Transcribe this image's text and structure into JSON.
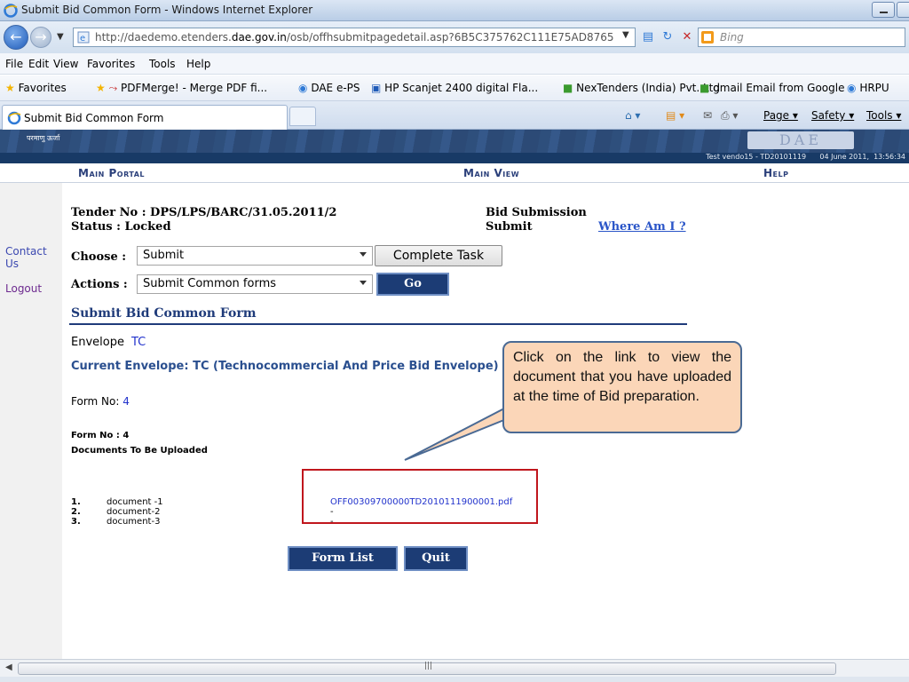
{
  "window": {
    "title": "Submit Bid Common Form - Windows Internet Explorer"
  },
  "address": {
    "url_prefix": "http://daedemo.etenders.",
    "url_domain": "dae.gov.in",
    "url_suffix": "/osb/offhsubmitpagedetail.asp?6B5C375762C111E75AD8765EI",
    "search_placeholder": "Bing"
  },
  "menu": [
    "File",
    "Edit",
    "View",
    "Favorites",
    "Tools",
    "Help"
  ],
  "favorites": {
    "label": "Favorites",
    "items": [
      "PDFMerge! - Merge PDF fi...",
      "DAE e-PS",
      "HP Scanjet 2400 digital Fla...",
      "NexTenders (India) Pvt. Ltd",
      "gmail Email from Google",
      "HRPU"
    ]
  },
  "tab": {
    "title": "Submit Bid Common Form",
    "tools": [
      "Page ▾",
      "Safety ▾",
      "Tools ▾"
    ]
  },
  "header": {
    "hindi_text": "परमाणु ऊर्जा",
    "logo_text": "DAE",
    "info": "Test vendo15 - TD20101119      04 June 2011,  13:56:34"
  },
  "nav": {
    "main_portal": "Main Portal",
    "main_view": "Main View",
    "help": "Help"
  },
  "sidebar": {
    "contact": "Contact Us",
    "logout": "Logout"
  },
  "tender": {
    "tender_no": "Tender No : DPS/LPS/BARC/31.05.2011/2",
    "status": "Status : Locked",
    "bid_submission": "Bid Submission",
    "submit": "Submit",
    "where_am_i": "Where Am I ?"
  },
  "form": {
    "choose_label": "Choose :",
    "choose_value": "Submit",
    "complete_task": "Complete Task",
    "actions_label": "Actions :",
    "actions_value": "Submit Common forms",
    "go": "Go",
    "section_title": "Submit Bid Common Form",
    "envelope_label": "Envelope",
    "envelope_value": "TC",
    "current_envelope": "Current Envelope: TC (Technocommercial And Price Bid Envelope)",
    "form_no_label": "Form No:",
    "form_no_value": "4",
    "form_no_small": "Form No : 4",
    "documents_heading": "Documents To Be Uploaded"
  },
  "documents": [
    {
      "num": "1.",
      "name": "document -1",
      "file": "OFF00309700000TD2010111900001.pdf"
    },
    {
      "num": "2.",
      "name": "document-2",
      "file": "-"
    },
    {
      "num": "3.",
      "name": "document-3",
      "file": "-"
    }
  ],
  "buttons": {
    "form_list": "Form List",
    "quit": "Quit"
  },
  "callout": {
    "text": "Click on the link to view the document that you have uploaded at the time of Bid preparation."
  },
  "colors": {
    "navy": "#1c3c75",
    "link_blue": "#2233cc",
    "callout_fill": "#fbd6b8",
    "highlight_red": "#c0161d"
  }
}
